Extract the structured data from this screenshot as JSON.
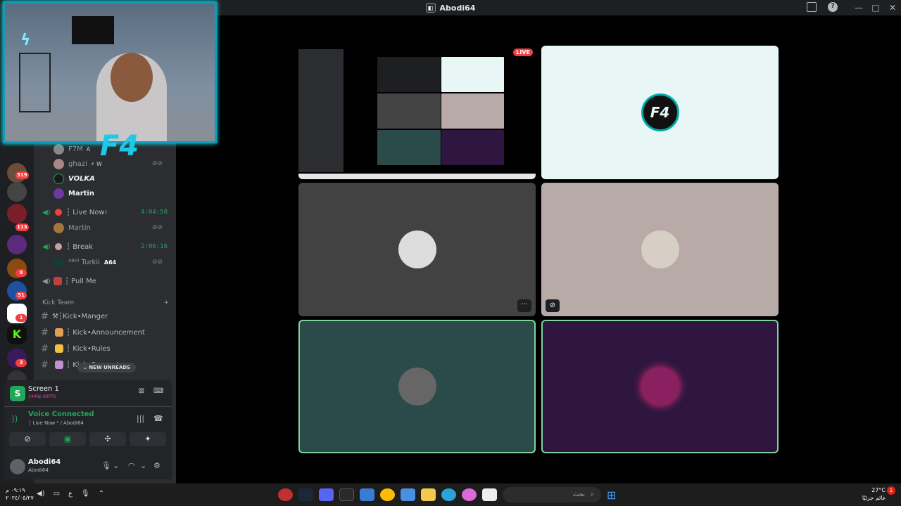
{
  "window": {
    "title": "Abodi64",
    "controls": [
      "—",
      "□",
      "✕"
    ]
  },
  "servers": {
    "badges": [
      "319",
      "113",
      "8",
      "51",
      "1",
      "3"
    ],
    "kick_letter": "K"
  },
  "channels": {
    "users_top": [
      {
        "name": "F7M",
        "tag": "A"
      },
      {
        "name": "ghazi",
        "tag": "⚡ W"
      },
      {
        "name": "VOLKA"
      },
      {
        "name": "Martin"
      }
    ],
    "live_now": {
      "name": "┆ Live Now",
      "sup": "2",
      "time": "4:04:58",
      "user": "Martin"
    },
    "break": {
      "name": "┆ Break",
      "time": "2:06:16",
      "user": "ᴬᴮᴰᴵ Turkii",
      "user_tag": "A64"
    },
    "pull_me": "┆ Pull Me",
    "category": "Kick Team",
    "category_plus": "+",
    "text_channels": [
      "⚒┆Kick•Manger",
      "┆ Kick•Announcement",
      "┆ Kick•Rules",
      "┆ Kick•Support"
    ],
    "new_unreads": "NEW UNREADS"
  },
  "stream_panel": {
    "title": "Screen 1",
    "quality": "1440p 60FPS",
    "voice_status": "Voice Connected",
    "voice_channel": "┆ Live Now ² / Abodi64"
  },
  "user_panel": {
    "name": "Abodi64",
    "sub": "Abodi64"
  },
  "tiles": {
    "live_label": "LIVE",
    "f4_logo": "F4",
    "menu": "···"
  },
  "webcam": {
    "logo": "F4"
  },
  "taskbar": {
    "time": "٠٩:١٩ م",
    "date": "٢٠٢٤/٠٥/٢٧",
    "lang": "ع",
    "search_placeholder": "بحث",
    "weather_temp": "27°C",
    "weather_text": "غائم جزئيًا",
    "notif": "1"
  }
}
